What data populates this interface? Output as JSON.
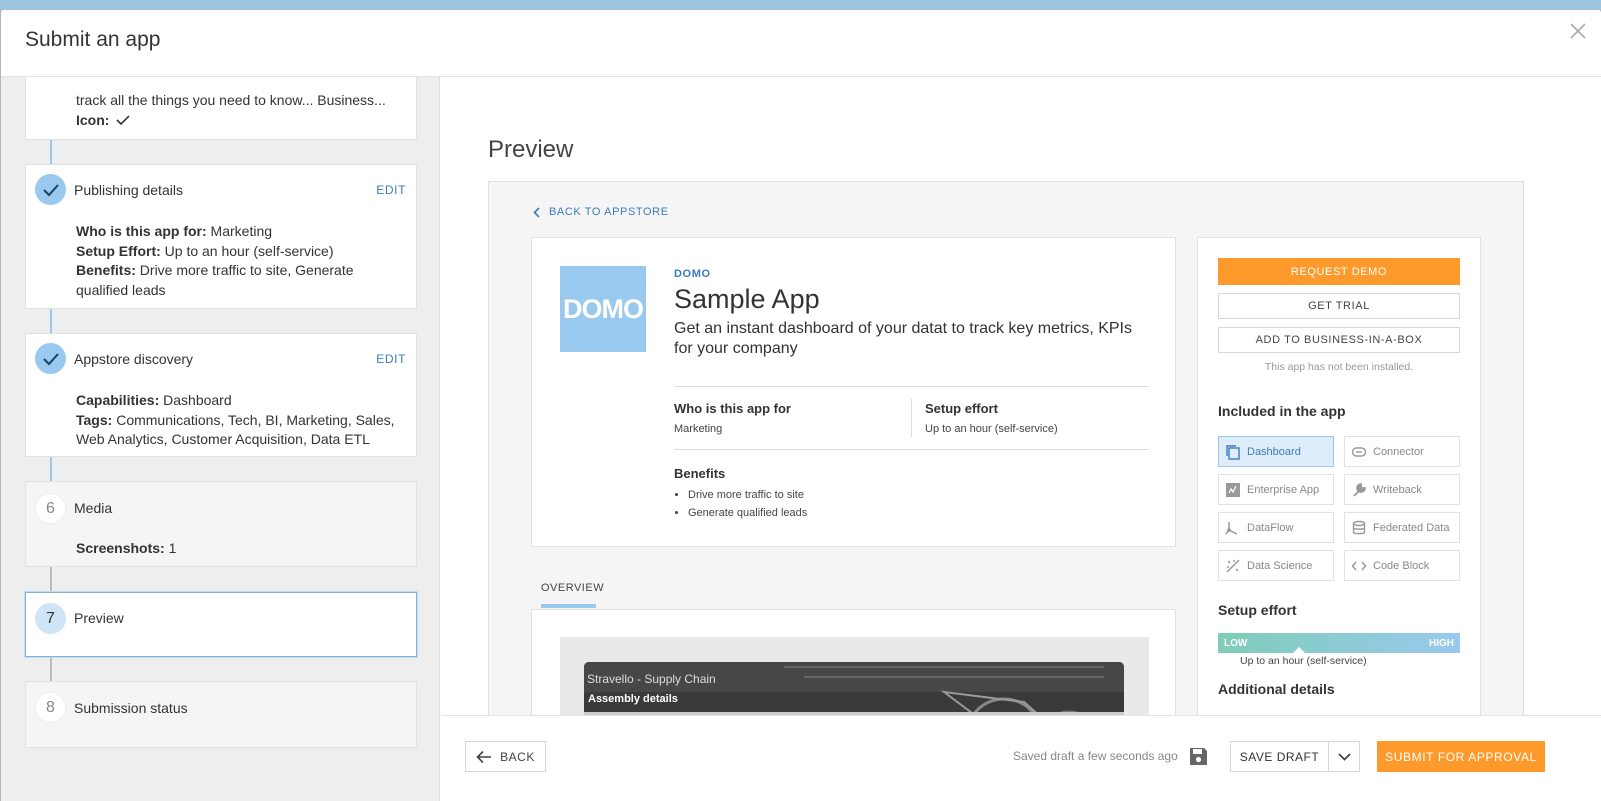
{
  "modal": {
    "title": "Submit an app"
  },
  "steps": {
    "app_info": {
      "line1": "track all the things you need to know... Business...",
      "icon_label": "Icon:"
    },
    "publishing": {
      "title": "Publishing details",
      "edit": "EDIT",
      "who_label": "Who is this app for:",
      "who_value": "Marketing",
      "setup_label": "Setup Effort:",
      "setup_value": "Up to an hour (self-service)",
      "benefits_label": "Benefits:",
      "benefits_value": "Drive more traffic to site, Generate qualified leads"
    },
    "discovery": {
      "title": "Appstore discovery",
      "edit": "EDIT",
      "cap_label": "Capabilities:",
      "cap_value": "Dashboard",
      "tags_label": "Tags:",
      "tags_value": "Communications, Tech, BI, Marketing, Sales, Web Analytics, Customer Acquisition, Data ETL"
    },
    "media": {
      "number": "6",
      "title": "Media",
      "shots_label": "Screenshots:",
      "shots_value": "1"
    },
    "preview": {
      "number": "7",
      "title": "Preview"
    },
    "submission": {
      "number": "8",
      "title": "Submission status"
    }
  },
  "preview": {
    "heading": "Preview",
    "back_link": "BACK TO APPSTORE",
    "logo_text": "DOMO",
    "publisher": "DOMO",
    "app_name": "Sample App",
    "description": "Get an instant dashboard of your datat to track key metrics, KPIs for your company",
    "who_label": "Who is this app for",
    "who_value": "Marketing",
    "setup_label": "Setup effort",
    "setup_value": "Up to an hour (self-service)",
    "benefits_label": "Benefits",
    "benefits": [
      "Drive more traffic to site",
      "Generate qualified leads"
    ],
    "tab_overview": "OVERVIEW",
    "screenshot_title": "Stravello - Supply Chain",
    "screenshot_sub": "Assembly details",
    "sidebar": {
      "request_demo": "REQUEST DEMO",
      "get_trial": "GET TRIAL",
      "add_box": "ADD TO BUSINESS-IN-A-BOX",
      "not_installed": "This app has not been installed.",
      "included_heading": "Included in the app",
      "features": [
        {
          "label": "Dashboard",
          "icon": "copy-icon",
          "active": true
        },
        {
          "label": "Connector",
          "icon": "link-icon",
          "active": false
        },
        {
          "label": "Enterprise App",
          "icon": "grid-app-icon",
          "active": false
        },
        {
          "label": "Writeback",
          "icon": "wrench-icon",
          "active": false
        },
        {
          "label": "DataFlow",
          "icon": "flow-icon",
          "active": false
        },
        {
          "label": "Federated Data",
          "icon": "database-icon",
          "active": false
        },
        {
          "label": "Data Science",
          "icon": "sparkle-icon",
          "active": false
        },
        {
          "label": "Code Block",
          "icon": "code-icon",
          "active": false
        }
      ],
      "setup_heading": "Setup effort",
      "effort_low": "LOW",
      "effort_high": "HIGH",
      "effort_value": "Up to an hour (self-service)",
      "additional_heading": "Additional details"
    }
  },
  "footer": {
    "back": "BACK",
    "saved": "Saved draft a few seconds ago",
    "save_draft": "SAVE DRAFT",
    "submit": "SUBMIT FOR APPROVAL"
  },
  "colors": {
    "accent_blue": "#3a7cc0",
    "light_blue": "#99c9ef",
    "orange": "#fd9a2b"
  }
}
